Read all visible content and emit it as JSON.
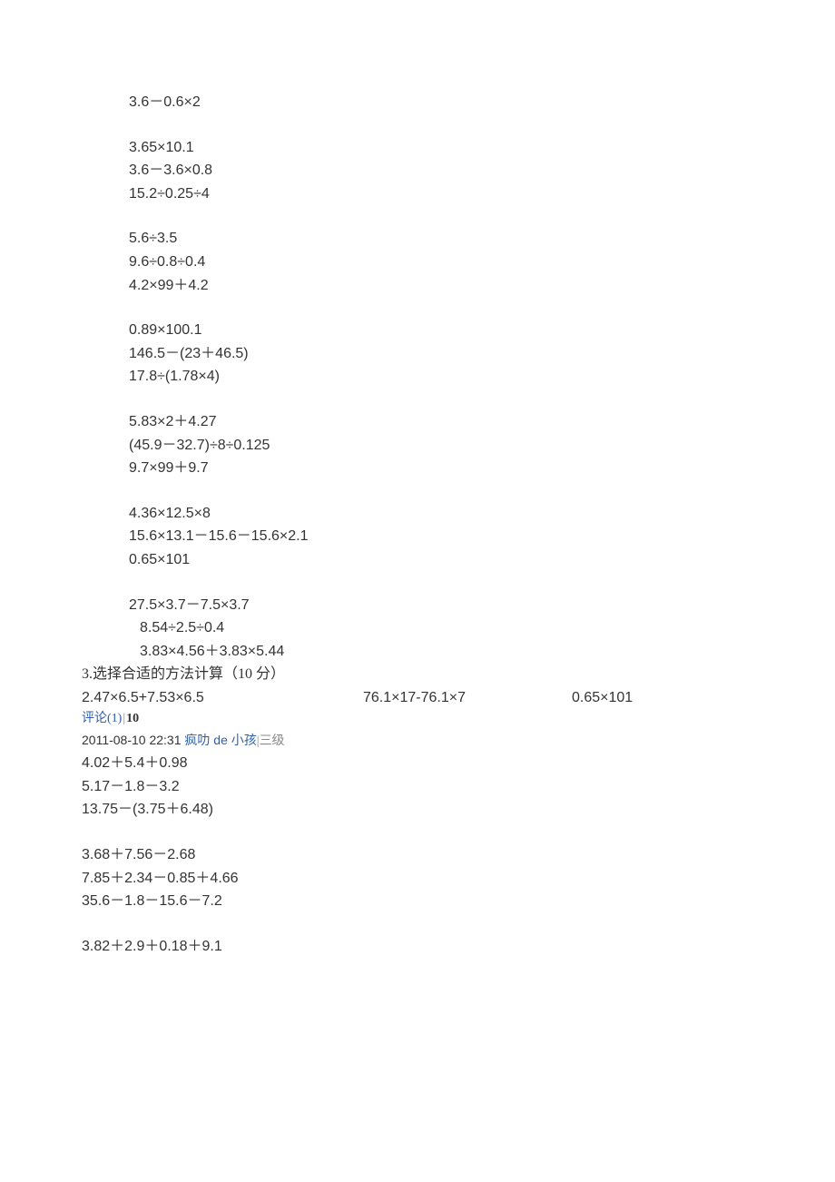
{
  "groups": [
    {
      "indent": "indent-block",
      "lines": [
        "3.6－0.6×2"
      ]
    },
    {
      "indent": "indent-block",
      "lines": [
        "3.65×10.1",
        "3.6－3.6×0.8",
        "15.2÷0.25÷4"
      ]
    },
    {
      "indent": "indent-block",
      "lines": [
        "5.6÷3.5",
        "9.6÷0.8÷0.4",
        "4.2×99＋4.2"
      ]
    },
    {
      "indent": "indent-block",
      "lines": [
        "0.89×100.1",
        "146.5－(23＋46.5)",
        "17.8÷(1.78×4)"
      ]
    },
    {
      "indent": "indent-block",
      "lines": [
        "5.83×2＋4.27",
        "(45.9－32.7)÷8÷0.125",
        "9.7×99＋9.7"
      ]
    },
    {
      "indent": "indent-block",
      "lines": [
        "4.36×12.5×8",
        "15.6×13.1－15.6－15.6×2.1",
        "0.65×101"
      ]
    }
  ],
  "group7_line1": "27.5×3.7－7.5×3.7",
  "group7_line2": "8.54÷2.5÷0.4",
  "group7_line3": "3.83×4.56＋3.83×5.44",
  "q3_title": "3.选择合适的方法计算（10 分）",
  "q3_col1": "2.47×6.5+7.53×6.5",
  "q3_col2": "76.1×17-76.1×7",
  "q3_col3": "0.65×101",
  "comment_label": "评论",
  "comment_count": "(1)",
  "comment_votes": "10",
  "timestamp": "2011-08-10 22:31",
  "username": "疯叻 de 小孩",
  "userlevel": "三级",
  "tail_groups": [
    {
      "lines": [
        "4.02＋5.4＋0.98",
        "5.17－1.8－3.2",
        "13.75－(3.75＋6.48)"
      ]
    },
    {
      "lines": [
        "3.68＋7.56－2.68",
        "7.85＋2.34－0.85＋4.66",
        "35.6－1.8－15.6－7.2"
      ]
    },
    {
      "lines": [
        "3.82＋2.9＋0.18＋9.1"
      ]
    }
  ]
}
